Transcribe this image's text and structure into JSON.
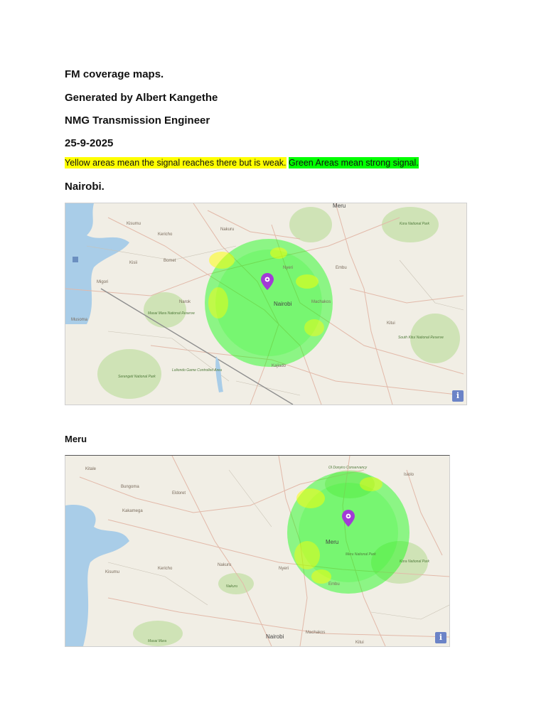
{
  "doc": {
    "title": "FM coverage maps.",
    "author_line": "Generated by Albert Kangethe",
    "role_line": "NMG Transmission Engineer",
    "date": "25-9-2025",
    "legend_yellow": "Yellow areas mean the signal reaches there but is weak.",
    "legend_green": "Green Areas mean strong signal."
  },
  "colors": {
    "strong": "#00ff00",
    "weak": "#ffff00",
    "marker": "#a23bd6",
    "water": "#a9cde8"
  },
  "maps": [
    {
      "heading": "Nairobi.",
      "labels": {
        "city_main": "Nairobi",
        "top": "Meru",
        "p1": "Kisumu",
        "p2": "Kericho",
        "p3": "Nakuru",
        "p4": "Nyeri",
        "p5": "Embu",
        "p6": "Kitui",
        "p7": "Machakos",
        "p8": "Kajiado",
        "p9": "Narok",
        "p10": "Bomet",
        "p11": "Kisii",
        "p12": "Migori",
        "p13": "Musoma",
        "park1": "Masai Mara National Reserve",
        "park2": "Serengeti National Park",
        "park3": "Loliondo Game Controlled Area",
        "park4": "Kora National Park",
        "park5": "South Kitui National Reserve"
      },
      "info_icon": "info-icon"
    },
    {
      "heading": "Meru",
      "labels": {
        "city_main": "Meru",
        "top": "Ol Donyiro Conservancy",
        "p1": "Kitale",
        "p2": "Bungoma",
        "p3": "Kakamega",
        "p4": "Kisumu",
        "p5": "Eldoret",
        "p6": "Nakuru",
        "p7": "Nyeri",
        "p8": "Embu",
        "p9": "Nairobi",
        "p10": "Machakos",
        "p11": "Kitui",
        "p12": "Isiolo",
        "p13": "Kericho",
        "park1": "Kora National Park",
        "park2": "Meru National Park",
        "park3": "Masai Mara",
        "park4": "Nakuru"
      },
      "info_icon": "info-icon"
    }
  ]
}
